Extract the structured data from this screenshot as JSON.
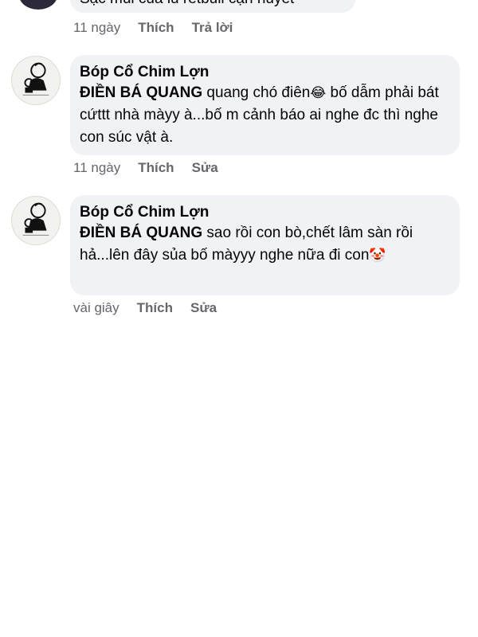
{
  "comments": [
    {
      "text": "Sặc mùi của lũ retbull cạn huyết",
      "meta": {
        "time": "11 ngày",
        "like": "Thích",
        "action": "Trả lời"
      }
    },
    {
      "author": "Bóp Cổ Chim Lợn",
      "tag": "ĐIỀN BÁ QUANG",
      "text_before_emoji": " quang chó điên",
      "emoji": "😂",
      "text_after_emoji": " bố dẫm phải bát cứttt nhà màyy à...bố m cảnh báo ai nghe đc thì nghe con súc vật à.",
      "meta": {
        "time": "11 ngày",
        "like": "Thích",
        "action": "Sửa"
      }
    },
    {
      "author": "Bóp Cổ Chim Lợn",
      "tag": "ĐIỀN BÁ QUANG",
      "text": " sao rồi con bò,chết lâm sàn rồi hả...lên đây sủa bố màyyy nghe nữa đi con",
      "emoji": "🤡",
      "meta": {
        "time": "vài giây",
        "like": "Thích",
        "action": "Sửa"
      }
    }
  ],
  "colors": {
    "bubble": "#f0f2f5",
    "meta_text": "#65676b",
    "text": "#050505"
  },
  "icons": {
    "avatar_top": "user-avatar-icon",
    "avatar_comment": "sketch-avatar-icon"
  }
}
